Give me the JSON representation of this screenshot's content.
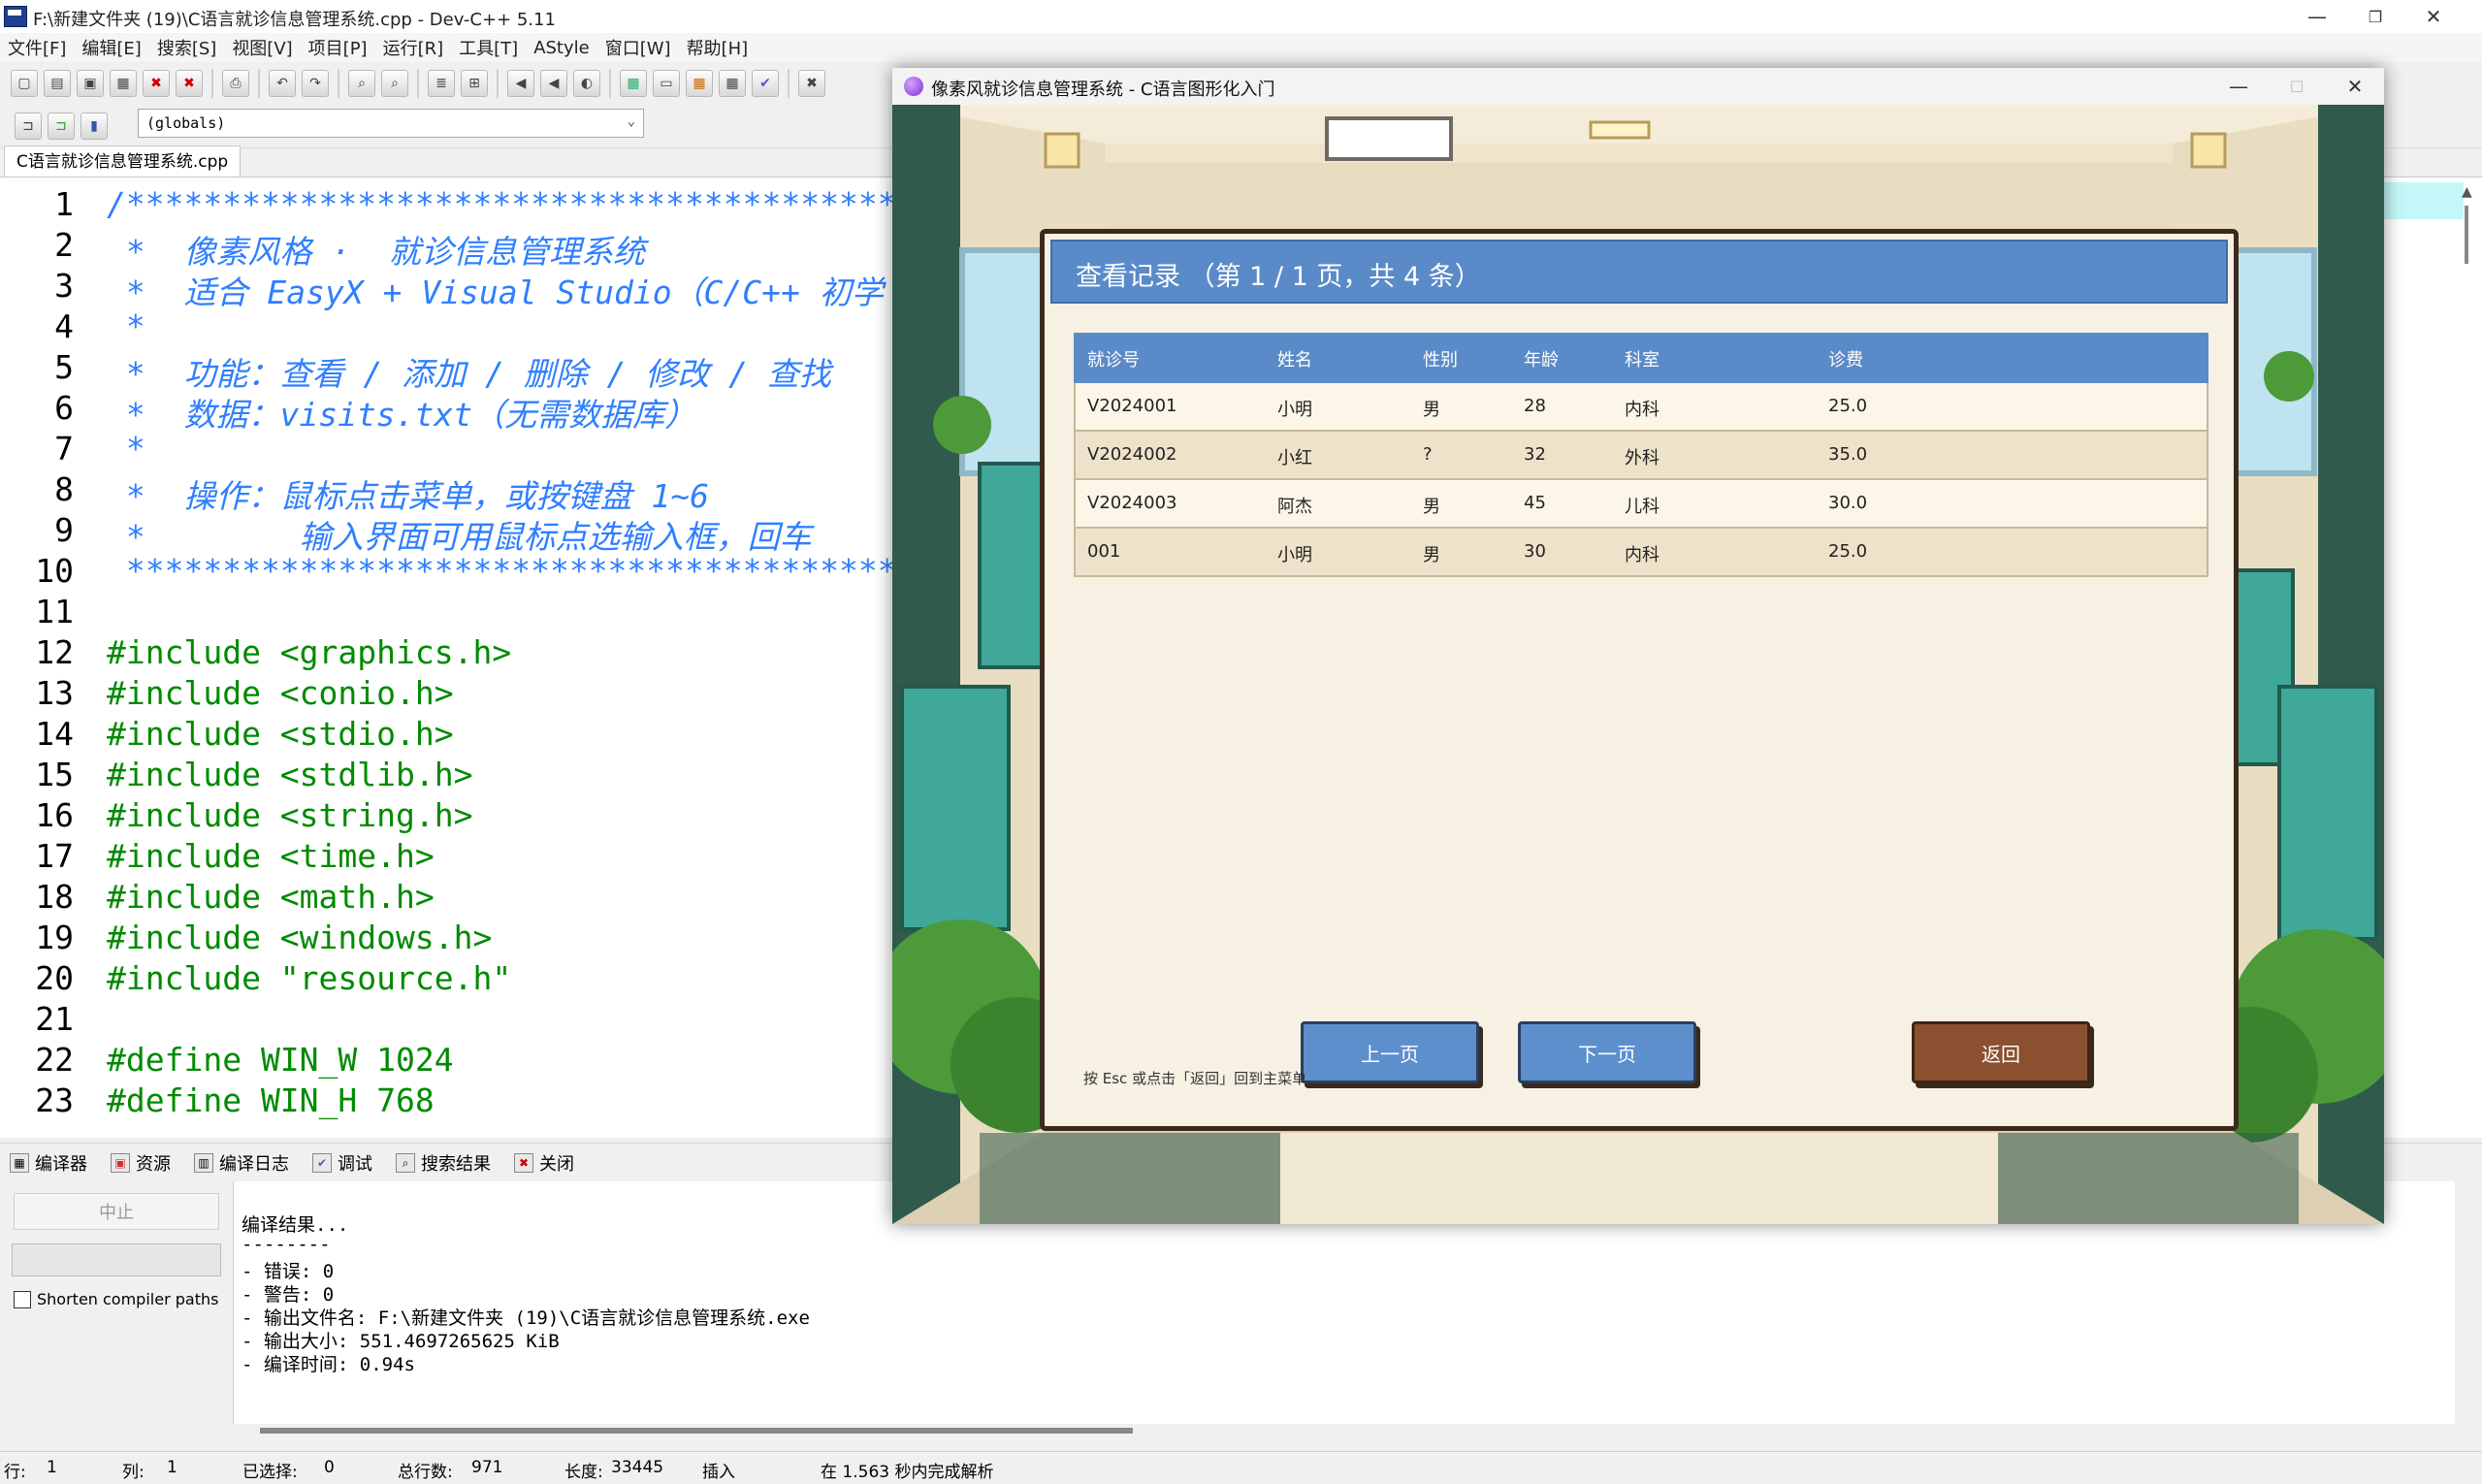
{
  "ide": {
    "title": "F:\\新建文件夹 (19)\\C语言就诊信息管理系统.cpp - Dev-C++ 5.11",
    "menu": [
      "文件[F]",
      "编辑[E]",
      "搜索[S]",
      "视图[V]",
      "项目[P]",
      "运行[R]",
      "工具[T]",
      "AStyle",
      "窗口[W]",
      "帮助[H]"
    ],
    "scope_select": "(globals)",
    "file_tab": "C语言就诊信息管理系统.cpp",
    "code_lines": [
      {
        "n": "1",
        "text": "/******************************************",
        "cls": "c-comment"
      },
      {
        "n": "2",
        "text": " *  像素风格 ·  就诊信息管理系统",
        "cls": "c-comment"
      },
      {
        "n": "3",
        "text": " *  适合 EasyX + Visual Studio（C/C++ 初学",
        "cls": "c-comment"
      },
      {
        "n": "4",
        "text": " *",
        "cls": "c-comment"
      },
      {
        "n": "5",
        "text": " *  功能：查看 / 添加 / 删除 / 修改 / 查找",
        "cls": "c-comment"
      },
      {
        "n": "6",
        "text": " *  数据：visits.txt（无需数据库）",
        "cls": "c-comment"
      },
      {
        "n": "7",
        "text": " *",
        "cls": "c-comment"
      },
      {
        "n": "8",
        "text": " *  操作：鼠标点击菜单，或按键盘 1~6",
        "cls": "c-comment"
      },
      {
        "n": "9",
        "text": " *        输入界面可用鼠标点选输入框，回车",
        "cls": "c-comment"
      },
      {
        "n": "10",
        "text": " ******************************************",
        "cls": "c-comment"
      },
      {
        "n": "11",
        "text": "",
        "cls": "c-pre"
      },
      {
        "n": "12",
        "text": "#include <graphics.h>",
        "cls": "c-pre"
      },
      {
        "n": "13",
        "text": "#include <conio.h>",
        "cls": "c-pre"
      },
      {
        "n": "14",
        "text": "#include <stdio.h>",
        "cls": "c-pre"
      },
      {
        "n": "15",
        "text": "#include <stdlib.h>",
        "cls": "c-pre"
      },
      {
        "n": "16",
        "text": "#include <string.h>",
        "cls": "c-pre"
      },
      {
        "n": "17",
        "text": "#include <time.h>",
        "cls": "c-pre"
      },
      {
        "n": "18",
        "text": "#include <math.h>",
        "cls": "c-pre"
      },
      {
        "n": "19",
        "text": "#include <windows.h>",
        "cls": "c-pre"
      },
      {
        "n": "20",
        "text": "#include \"resource.h\"",
        "cls": "c-pre"
      },
      {
        "n": "21",
        "text": "",
        "cls": "c-pre"
      },
      {
        "n": "22",
        "text": "#define WIN_W 1024",
        "cls": "c-pre"
      },
      {
        "n": "23",
        "text": "#define WIN_H 768",
        "cls": "c-pre"
      }
    ],
    "bottom_tabs": [
      {
        "label": "编译器",
        "icon": "compiler-grid-icon"
      },
      {
        "label": "资源",
        "icon": "resources-icon"
      },
      {
        "label": "编译日志",
        "icon": "compile-log-chart-icon"
      },
      {
        "label": "调试",
        "icon": "debug-check-icon"
      },
      {
        "label": "搜索结果",
        "icon": "search-results-icon"
      },
      {
        "label": "关闭",
        "icon": "close-tab-icon"
      }
    ],
    "stop_button": "中止",
    "shorten_paths": "Shorten compiler paths",
    "log_lines": [
      "编译结果...",
      "--------",
      "- 错误: 0",
      "- 警告: 0",
      "- 输出文件名: F:\\新建文件夹 (19)\\C语言就诊信息管理系统.exe",
      "- 输出大小: 551.4697265625 KiB",
      "- 编译时间: 0.94s"
    ],
    "status": {
      "row_label": "行:",
      "row": "1",
      "col_label": "列:",
      "col": "1",
      "sel_label": "已选择:",
      "sel": "0",
      "lines_label": "总行数:",
      "lines": "971",
      "len_label": "长度:",
      "len": "33445",
      "mode": "插入",
      "parse": "在 1.563 秒内完成解析"
    }
  },
  "app": {
    "title": "像素风就诊信息管理系统 - C语言图形化入门",
    "dialog_title": "查看记录 （第 1 / 1 页，共 4 条）",
    "columns": [
      "就诊号",
      "姓名",
      "性别",
      "年龄",
      "科室",
      "诊费"
    ],
    "rows": [
      [
        "V2024001",
        "小明",
        "男",
        "28",
        "内科",
        "25.0"
      ],
      [
        "V2024002",
        "小红",
        "?",
        "32",
        "外科",
        "35.0"
      ],
      [
        "V2024003",
        "阿杰",
        "男",
        "45",
        "儿科",
        "30.0"
      ],
      [
        "001",
        "小明",
        "男",
        "30",
        "内科",
        "25.0"
      ]
    ],
    "prev_button": "上一页",
    "next_button": "下一页",
    "back_button": "返回",
    "hint": "按 Esc 或点击「返回」回到主菜单"
  }
}
